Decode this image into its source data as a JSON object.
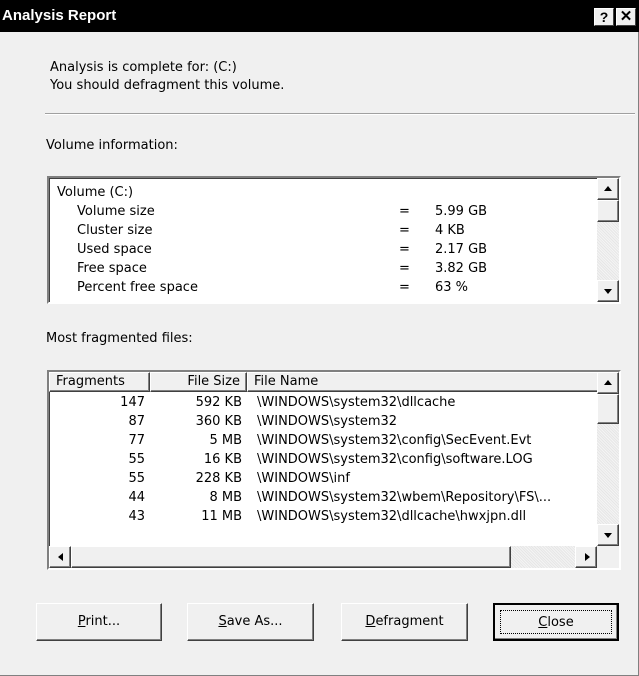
{
  "window": {
    "title": "Analysis Report",
    "help_glyph": "?",
    "close_glyph": "✕"
  },
  "summary": {
    "line1": "Analysis is complete for: (C:)",
    "line2": "You should defragment this volume."
  },
  "volume_section": {
    "heading": "Volume information:",
    "volume_label": "Volume (C:)",
    "rows": [
      {
        "label": "Volume size",
        "eq": "=",
        "value": "5.99 GB"
      },
      {
        "label": "Cluster size",
        "eq": "=",
        "value": "4 KB"
      },
      {
        "label": "Used space",
        "eq": "=",
        "value": "2.17 GB"
      },
      {
        "label": "Free space",
        "eq": "=",
        "value": "3.82 GB"
      },
      {
        "label": "Percent free space",
        "eq": "=",
        "value": "63 %"
      }
    ]
  },
  "files_section": {
    "heading": "Most fragmented files:",
    "columns": {
      "fragments": "Fragments",
      "file_size": "File Size",
      "file_name": "File Name"
    },
    "rows": [
      {
        "fragments": "147",
        "size": "592 KB",
        "name": "\\WINDOWS\\system32\\dllcache"
      },
      {
        "fragments": "87",
        "size": "360 KB",
        "name": "\\WINDOWS\\system32"
      },
      {
        "fragments": "77",
        "size": "5 MB",
        "name": "\\WINDOWS\\system32\\config\\SecEvent.Evt"
      },
      {
        "fragments": "55",
        "size": "16 KB",
        "name": "\\WINDOWS\\system32\\config\\software.LOG"
      },
      {
        "fragments": "55",
        "size": "228 KB",
        "name": "\\WINDOWS\\inf"
      },
      {
        "fragments": "44",
        "size": "8 MB",
        "name": "\\WINDOWS\\system32\\wbem\\Repository\\FS\\..."
      },
      {
        "fragments": "43",
        "size": "11 MB",
        "name": "\\WINDOWS\\system32\\dllcache\\hwxjpn.dll"
      }
    ]
  },
  "buttons": {
    "print": {
      "mnemonic": "P",
      "rest": "rint..."
    },
    "save_as": {
      "mnemonic": "S",
      "rest": "ave As..."
    },
    "defragment": {
      "mnemonic": "D",
      "rest": "efragment"
    },
    "close": {
      "mnemonic": "C",
      "rest": "lose"
    }
  },
  "icons": {
    "scroll_up": "arrow-up",
    "scroll_down": "arrow-down",
    "scroll_left": "arrow-left",
    "scroll_right": "arrow-right"
  }
}
